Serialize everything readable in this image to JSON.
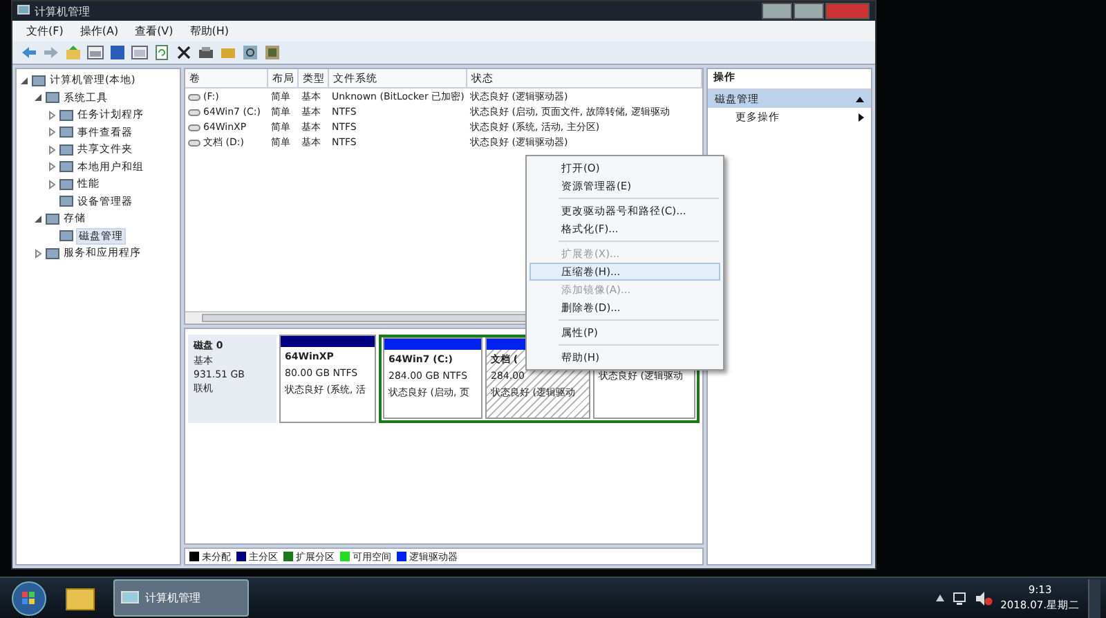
{
  "window": {
    "title": "计算机管理"
  },
  "menu": [
    "文件(F)",
    "操作(A)",
    "查看(V)",
    "帮助(H)"
  ],
  "tree": [
    {
      "label": "计算机管理(本地)",
      "expanded": true,
      "selected": false,
      "children": [
        {
          "label": "系统工具",
          "expanded": true,
          "selected": false,
          "children": [
            {
              "label": "任务计划程序",
              "expanded": false,
              "selected": false
            },
            {
              "label": "事件查看器",
              "expanded": false,
              "selected": false
            },
            {
              "label": "共享文件夹",
              "expanded": false,
              "selected": false
            },
            {
              "label": "本地用户和组",
              "expanded": false,
              "selected": false
            },
            {
              "label": "性能",
              "expanded": false,
              "selected": false
            },
            {
              "label": "设备管理器",
              "selected": false
            }
          ]
        },
        {
          "label": "存储",
          "expanded": true,
          "selected": false,
          "children": [
            {
              "label": "磁盘管理",
              "selected": true
            }
          ]
        },
        {
          "label": "服务和应用程序",
          "expanded": false,
          "selected": false
        }
      ]
    }
  ],
  "volumes": {
    "columns": [
      "卷",
      "布局",
      "类型",
      "文件系统",
      "状态"
    ],
    "rows": [
      {
        "cells": [
          "(F:)",
          "简单",
          "基本",
          "Unknown (BitLocker 已加密)",
          "状态良好 (逻辑驱动器)"
        ]
      },
      {
        "cells": [
          "64Win7  (C:)",
          "简单",
          "基本",
          "NTFS",
          "状态良好 (启动, 页面文件, 故障转储, 逻辑驱动"
        ]
      },
      {
        "cells": [
          "64WinXP",
          "简单",
          "基本",
          "NTFS",
          "状态良好 (系统, 活动, 主分区)"
        ]
      },
      {
        "cells": [
          "文档 (D:)",
          "简单",
          "基本",
          "NTFS",
          "状态良好 (逻辑驱动器)"
        ]
      }
    ]
  },
  "disk": {
    "name": "磁盘 0",
    "type": "基本",
    "size": "931.51 GB",
    "status": "联机",
    "partitions": [
      {
        "kind": "primary",
        "extended": false,
        "selected": false,
        "name": "64WinXP",
        "size": "80.00 GB NTFS",
        "status": "状态良好 (系统, 活"
      },
      {
        "kind": "logical",
        "extended": true,
        "selected": false,
        "name": "64Win7  (C:)",
        "size": "284.00 GB NTFS",
        "status": "状态良好 (启动, 页"
      },
      {
        "kind": "logical",
        "extended": true,
        "selected": true,
        "name": "文档 (",
        "size": "284.00",
        "status": "状态良好 (逻辑驱动"
      },
      {
        "kind": "logical",
        "extended": true,
        "selected": false,
        "status": "状态良好 (逻辑驱动"
      }
    ]
  },
  "legend": [
    {
      "label": "未分配",
      "color": "#000000"
    },
    {
      "label": "主分区",
      "color": "#000080"
    },
    {
      "label": "扩展分区",
      "color": "#1a7a1a"
    },
    {
      "label": "可用空间",
      "color": "#22dd22"
    },
    {
      "label": "逻辑驱动器",
      "color": "#0022ee"
    }
  ],
  "actions": {
    "title": "操作",
    "section": "磁盘管理",
    "items": [
      "更多操作"
    ]
  },
  "context_menu": [
    {
      "label": "打开(O)",
      "disabled": false,
      "selected": false,
      "separator_after": false
    },
    {
      "label": "资源管理器(E)",
      "disabled": false,
      "selected": false,
      "separator_after": true
    },
    {
      "label": "更改驱动器号和路径(C)...",
      "disabled": false,
      "selected": false,
      "separator_after": false
    },
    {
      "label": "格式化(F)...",
      "disabled": false,
      "selected": false,
      "separator_after": true
    },
    {
      "label": "扩展卷(X)...",
      "disabled": true,
      "selected": false,
      "separator_after": false
    },
    {
      "label": "压缩卷(H)...",
      "disabled": false,
      "selected": true,
      "separator_after": false
    },
    {
      "label": "添加镜像(A)...",
      "disabled": true,
      "selected": false,
      "separator_after": false
    },
    {
      "label": "删除卷(D)...",
      "disabled": false,
      "selected": false,
      "separator_after": true
    },
    {
      "label": "属性(P)",
      "disabled": false,
      "selected": false,
      "separator_after": true
    },
    {
      "label": "帮助(H)",
      "disabled": false,
      "selected": false,
      "separator_after": false
    }
  ],
  "taskbar": {
    "task": "计算机管理",
    "time": "9:13",
    "date": "2018.07.星期二"
  }
}
